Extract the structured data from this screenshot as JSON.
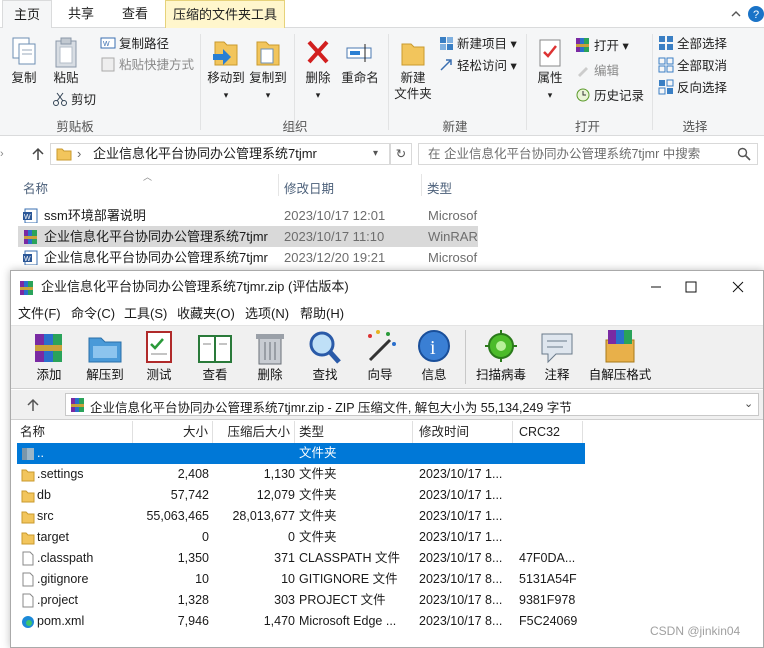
{
  "ribbon": {
    "tabs": [
      "主页",
      "共享",
      "查看",
      "压缩的文件夹工具"
    ],
    "groups": {
      "clipboard": {
        "label": "剪贴板",
        "copy": "复制",
        "paste": "粘贴",
        "copy_path": "复制路径",
        "paste_shortcut": "粘贴快捷方式",
        "cut": "剪切"
      },
      "organize": {
        "label": "组织",
        "move_to": "移动到",
        "copy_to": "复制到",
        "delete": "删除",
        "rename": "重命名"
      },
      "new": {
        "label": "新建",
        "new_folder_1": "新建",
        "new_folder_2": "文件夹",
        "new_item": "新建项目",
        "easy_access": "轻松访问"
      },
      "open": {
        "label": "打开",
        "properties": "属性",
        "open": "打开",
        "edit": "编辑",
        "history": "历史记录"
      },
      "select": {
        "label": "选择",
        "select_all": "全部选择",
        "select_none": "全部取消",
        "invert": "反向选择"
      }
    }
  },
  "explorer": {
    "address": "企业信息化平台协同办公管理系统7tjmr",
    "search_placeholder": "在 企业信息化平台协同办公管理系统7tjmr 中搜索",
    "columns": {
      "name": "名称",
      "modified": "修改日期",
      "type": "类型"
    },
    "files": [
      {
        "name": "ssm环境部署说明",
        "date": "2023/10/17 12:01",
        "type": "Microsof",
        "icon": "word-icon"
      },
      {
        "name": "企业信息化平台协同办公管理系统7tjmr",
        "date": "2023/10/17 11:10",
        "type": "WinRAR",
        "icon": "winrar-icon"
      },
      {
        "name": "企业信息化平台协同办公管理系统7tjmr",
        "date": "2023/12/20 19:21",
        "type": "Microsof",
        "icon": "word-icon"
      }
    ]
  },
  "winrar": {
    "title": "企业信息化平台协同办公管理系统7tjmr.zip (评估版本)",
    "menus": [
      "文件(F)",
      "命令(C)",
      "工具(S)",
      "收藏夹(O)",
      "选项(N)",
      "帮助(H)"
    ],
    "toolbar": [
      "添加",
      "解压到",
      "测试",
      "查看",
      "删除",
      "查找",
      "向导",
      "信息",
      "扫描病毒",
      "注释",
      "自解压格式"
    ],
    "path": "企业信息化平台协同办公管理系统7tjmr.zip - ZIP 压缩文件, 解包大小为 55,134,249 字节",
    "columns": {
      "name": "名称",
      "size": "大小",
      "packed": "压缩后大小",
      "type": "类型",
      "modified": "修改时间",
      "crc": "CRC32"
    },
    "rows": [
      {
        "name": "..",
        "size": "",
        "packed": "",
        "type": "文件夹",
        "modified": "",
        "crc": "",
        "icon": "folder-up-icon"
      },
      {
        "name": ".settings",
        "size": "2,408",
        "packed": "1,130",
        "type": "文件夹",
        "modified": "2023/10/17 1...",
        "crc": "",
        "icon": "folder-icon"
      },
      {
        "name": "db",
        "size": "57,742",
        "packed": "12,079",
        "type": "文件夹",
        "modified": "2023/10/17 1...",
        "crc": "",
        "icon": "folder-icon"
      },
      {
        "name": "src",
        "size": "55,063,465",
        "packed": "28,013,677",
        "type": "文件夹",
        "modified": "2023/10/17 1...",
        "crc": "",
        "icon": "folder-icon"
      },
      {
        "name": "target",
        "size": "0",
        "packed": "0",
        "type": "文件夹",
        "modified": "2023/10/17 1...",
        "crc": "",
        "icon": "folder-icon"
      },
      {
        "name": ".classpath",
        "size": "1,350",
        "packed": "371",
        "type": "CLASSPATH 文件",
        "modified": "2023/10/17 8...",
        "crc": "47F0DA...",
        "icon": "file-icon"
      },
      {
        "name": ".gitignore",
        "size": "10",
        "packed": "10",
        "type": "GITIGNORE 文件",
        "modified": "2023/10/17 8...",
        "crc": "5131A54F",
        "icon": "file-icon"
      },
      {
        "name": ".project",
        "size": "1,328",
        "packed": "303",
        "type": "PROJECT 文件",
        "modified": "2023/10/17 8...",
        "crc": "9381F978",
        "icon": "file-icon"
      },
      {
        "name": "pom.xml",
        "size": "7,946",
        "packed": "1,470",
        "type": "Microsoft Edge ...",
        "modified": "2023/10/17 8...",
        "crc": "F5C24069",
        "icon": "edge-icon"
      }
    ]
  },
  "watermark": "CSDN @jinkin04"
}
